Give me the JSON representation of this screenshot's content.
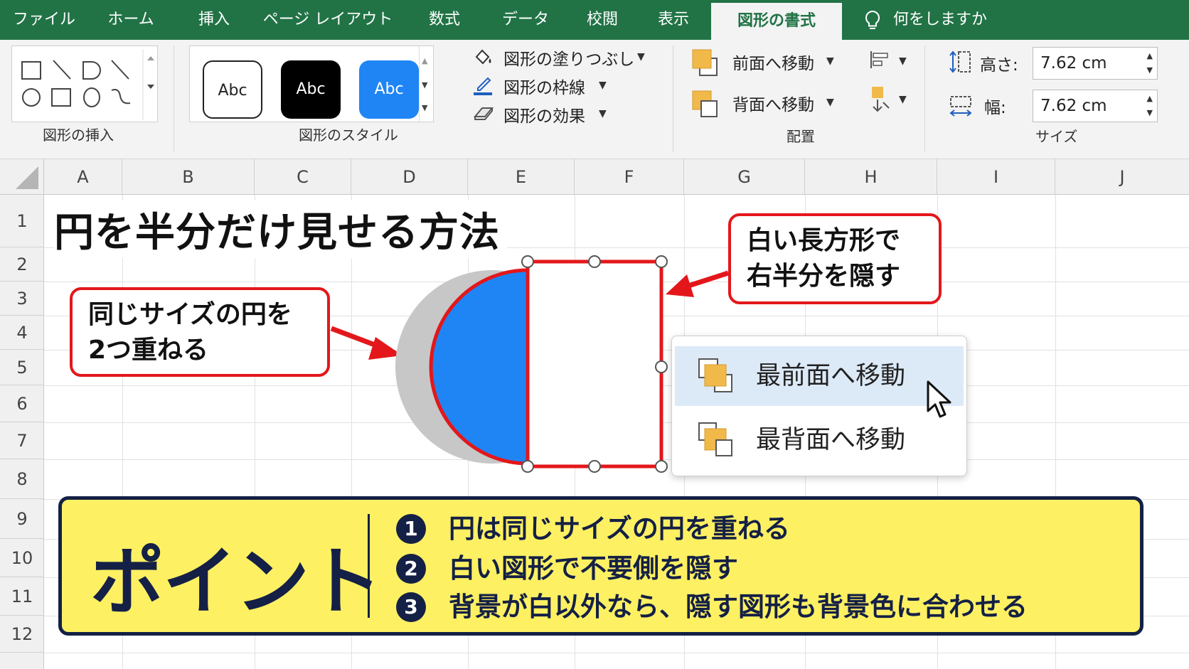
{
  "tabs": [
    "ファイル",
    "ホーム",
    "挿入",
    "ページ レイアウト",
    "数式",
    "データ",
    "校閲",
    "表示",
    "図形の書式"
  ],
  "active_tab": "図形の書式",
  "tell_me": "何をしますか",
  "ribbon": {
    "insert_shapes_label": "図形の挿入",
    "shape_styles_label": "図形のスタイル",
    "style_presets": [
      "Abc",
      "Abc",
      "Abc"
    ],
    "fill_label": "図形の塗りつぶし",
    "outline_label": "図形の枠線",
    "effects_label": "図形の効果",
    "bring_forward_label": "前面へ移動",
    "send_backward_label": "背面へ移動",
    "arrange_label": "配置",
    "height_label": "高さ:",
    "height_value": "7.62 cm",
    "width_label": "幅:",
    "width_value": "7.62 cm",
    "size_label": "サイズ"
  },
  "colors": {
    "excel_green": "#217346",
    "callout_red": "#e3171b",
    "circle_blue": "#1f85f5",
    "shadow_gray": "#c7c7c7",
    "point_yellow": "#fdf063",
    "point_navy": "#142045",
    "menu_highlight": "#dce9f7"
  },
  "columns": [
    "A",
    "B",
    "C",
    "D",
    "E",
    "F",
    "G",
    "H",
    "I",
    "J"
  ],
  "rows": [
    "1",
    "2",
    "3",
    "4",
    "5",
    "6",
    "7",
    "8",
    "9",
    "10",
    "11",
    "12"
  ],
  "sheet_title": "円を半分だけ見せる方法",
  "callout_left": [
    "同じサイズの円を",
    "2つ重ねる"
  ],
  "callout_right": [
    "白い長方形で",
    "右半分を隠す"
  ],
  "context_menu": {
    "item1": "最前面へ移動",
    "item2": "最背面へ移動"
  },
  "point": {
    "title": "ポイント",
    "items": [
      {
        "num": "1",
        "text": "円は同じサイズの円を重ねる"
      },
      {
        "num": "2",
        "text": "白い図形で不要側を隠す"
      },
      {
        "num": "3",
        "text": "背景が白以外なら、隠す図形も背景色に合わせる"
      }
    ]
  }
}
